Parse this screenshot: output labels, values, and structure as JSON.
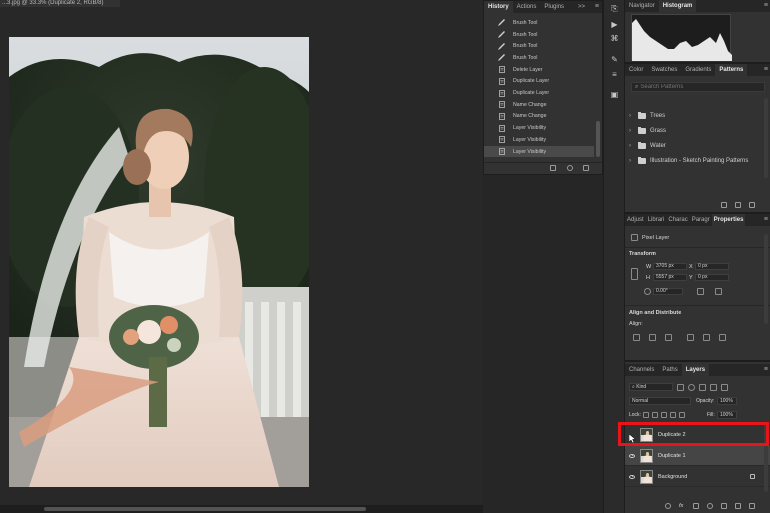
{
  "document": {
    "tab_title": "...3.jpg @ 33.3% (Duplicate 2, RGB/8)"
  },
  "history": {
    "tabs": [
      "History",
      "Actions",
      "Plugins"
    ],
    "expand_label": ">>",
    "menu_label": "≡",
    "items": [
      {
        "label": "Brush Tool",
        "type": "brush"
      },
      {
        "label": "Brush Tool",
        "type": "brush"
      },
      {
        "label": "Brush Tool",
        "type": "brush"
      },
      {
        "label": "Brush Tool",
        "type": "brush"
      },
      {
        "label": "Delete Layer",
        "type": "doc"
      },
      {
        "label": "Duplicate Layer",
        "type": "doc"
      },
      {
        "label": "Duplicate Layer",
        "type": "doc"
      },
      {
        "label": "Name Change",
        "type": "doc"
      },
      {
        "label": "Name Change",
        "type": "doc"
      },
      {
        "label": "Layer Visibility",
        "type": "doc"
      },
      {
        "label": "Layer Visibility",
        "type": "doc"
      },
      {
        "label": "Layer Visibility",
        "type": "doc",
        "selected": true
      }
    ]
  },
  "navigator": {
    "tabs": [
      "Navigator",
      "Histogram"
    ],
    "menu_label": "≡"
  },
  "patterns": {
    "tabs": [
      "Color",
      "Swatches",
      "Gradients",
      "Patterns"
    ],
    "menu_label": "≡",
    "search_placeholder": "Search Patterns",
    "folders": [
      "Trees",
      "Grass",
      "Water",
      "Illustration - Sketch Painting Patterns"
    ]
  },
  "properties": {
    "tabs": [
      "Adjust",
      "Librari",
      "Charac",
      "Paragr",
      "Properties"
    ],
    "menu_label": "≡",
    "layer_type": "Pixel Layer",
    "transform_label": "Transform",
    "w_label": "W",
    "w_value": "3705 px",
    "x_label": "X",
    "x_value": "0 px",
    "h_label": "H",
    "h_value": "5557 px",
    "y_label": "Y",
    "y_value": "0 px",
    "angle_value": "0.00°",
    "align_label": "Align and Distribute",
    "align_sub": "Align:"
  },
  "layers": {
    "tabs": [
      "Channels",
      "Paths",
      "Layers"
    ],
    "menu_label": "≡",
    "filter_label": "Kind",
    "blend_mode": "Normal",
    "opacity_label": "Opacity:",
    "opacity_value": "100%",
    "lock_label": "Lock:",
    "fill_label": "Fill:",
    "fill_value": "100%",
    "items": [
      {
        "name": "Duplicate 2",
        "visible": false
      },
      {
        "name": "Duplicate 1",
        "visible": true,
        "selected": true
      },
      {
        "name": "Background",
        "visible": true,
        "locked": true
      }
    ]
  },
  "colors": {
    "highlight": "#e8141a",
    "panel_bg": "#323232",
    "app_bg": "#262626"
  }
}
